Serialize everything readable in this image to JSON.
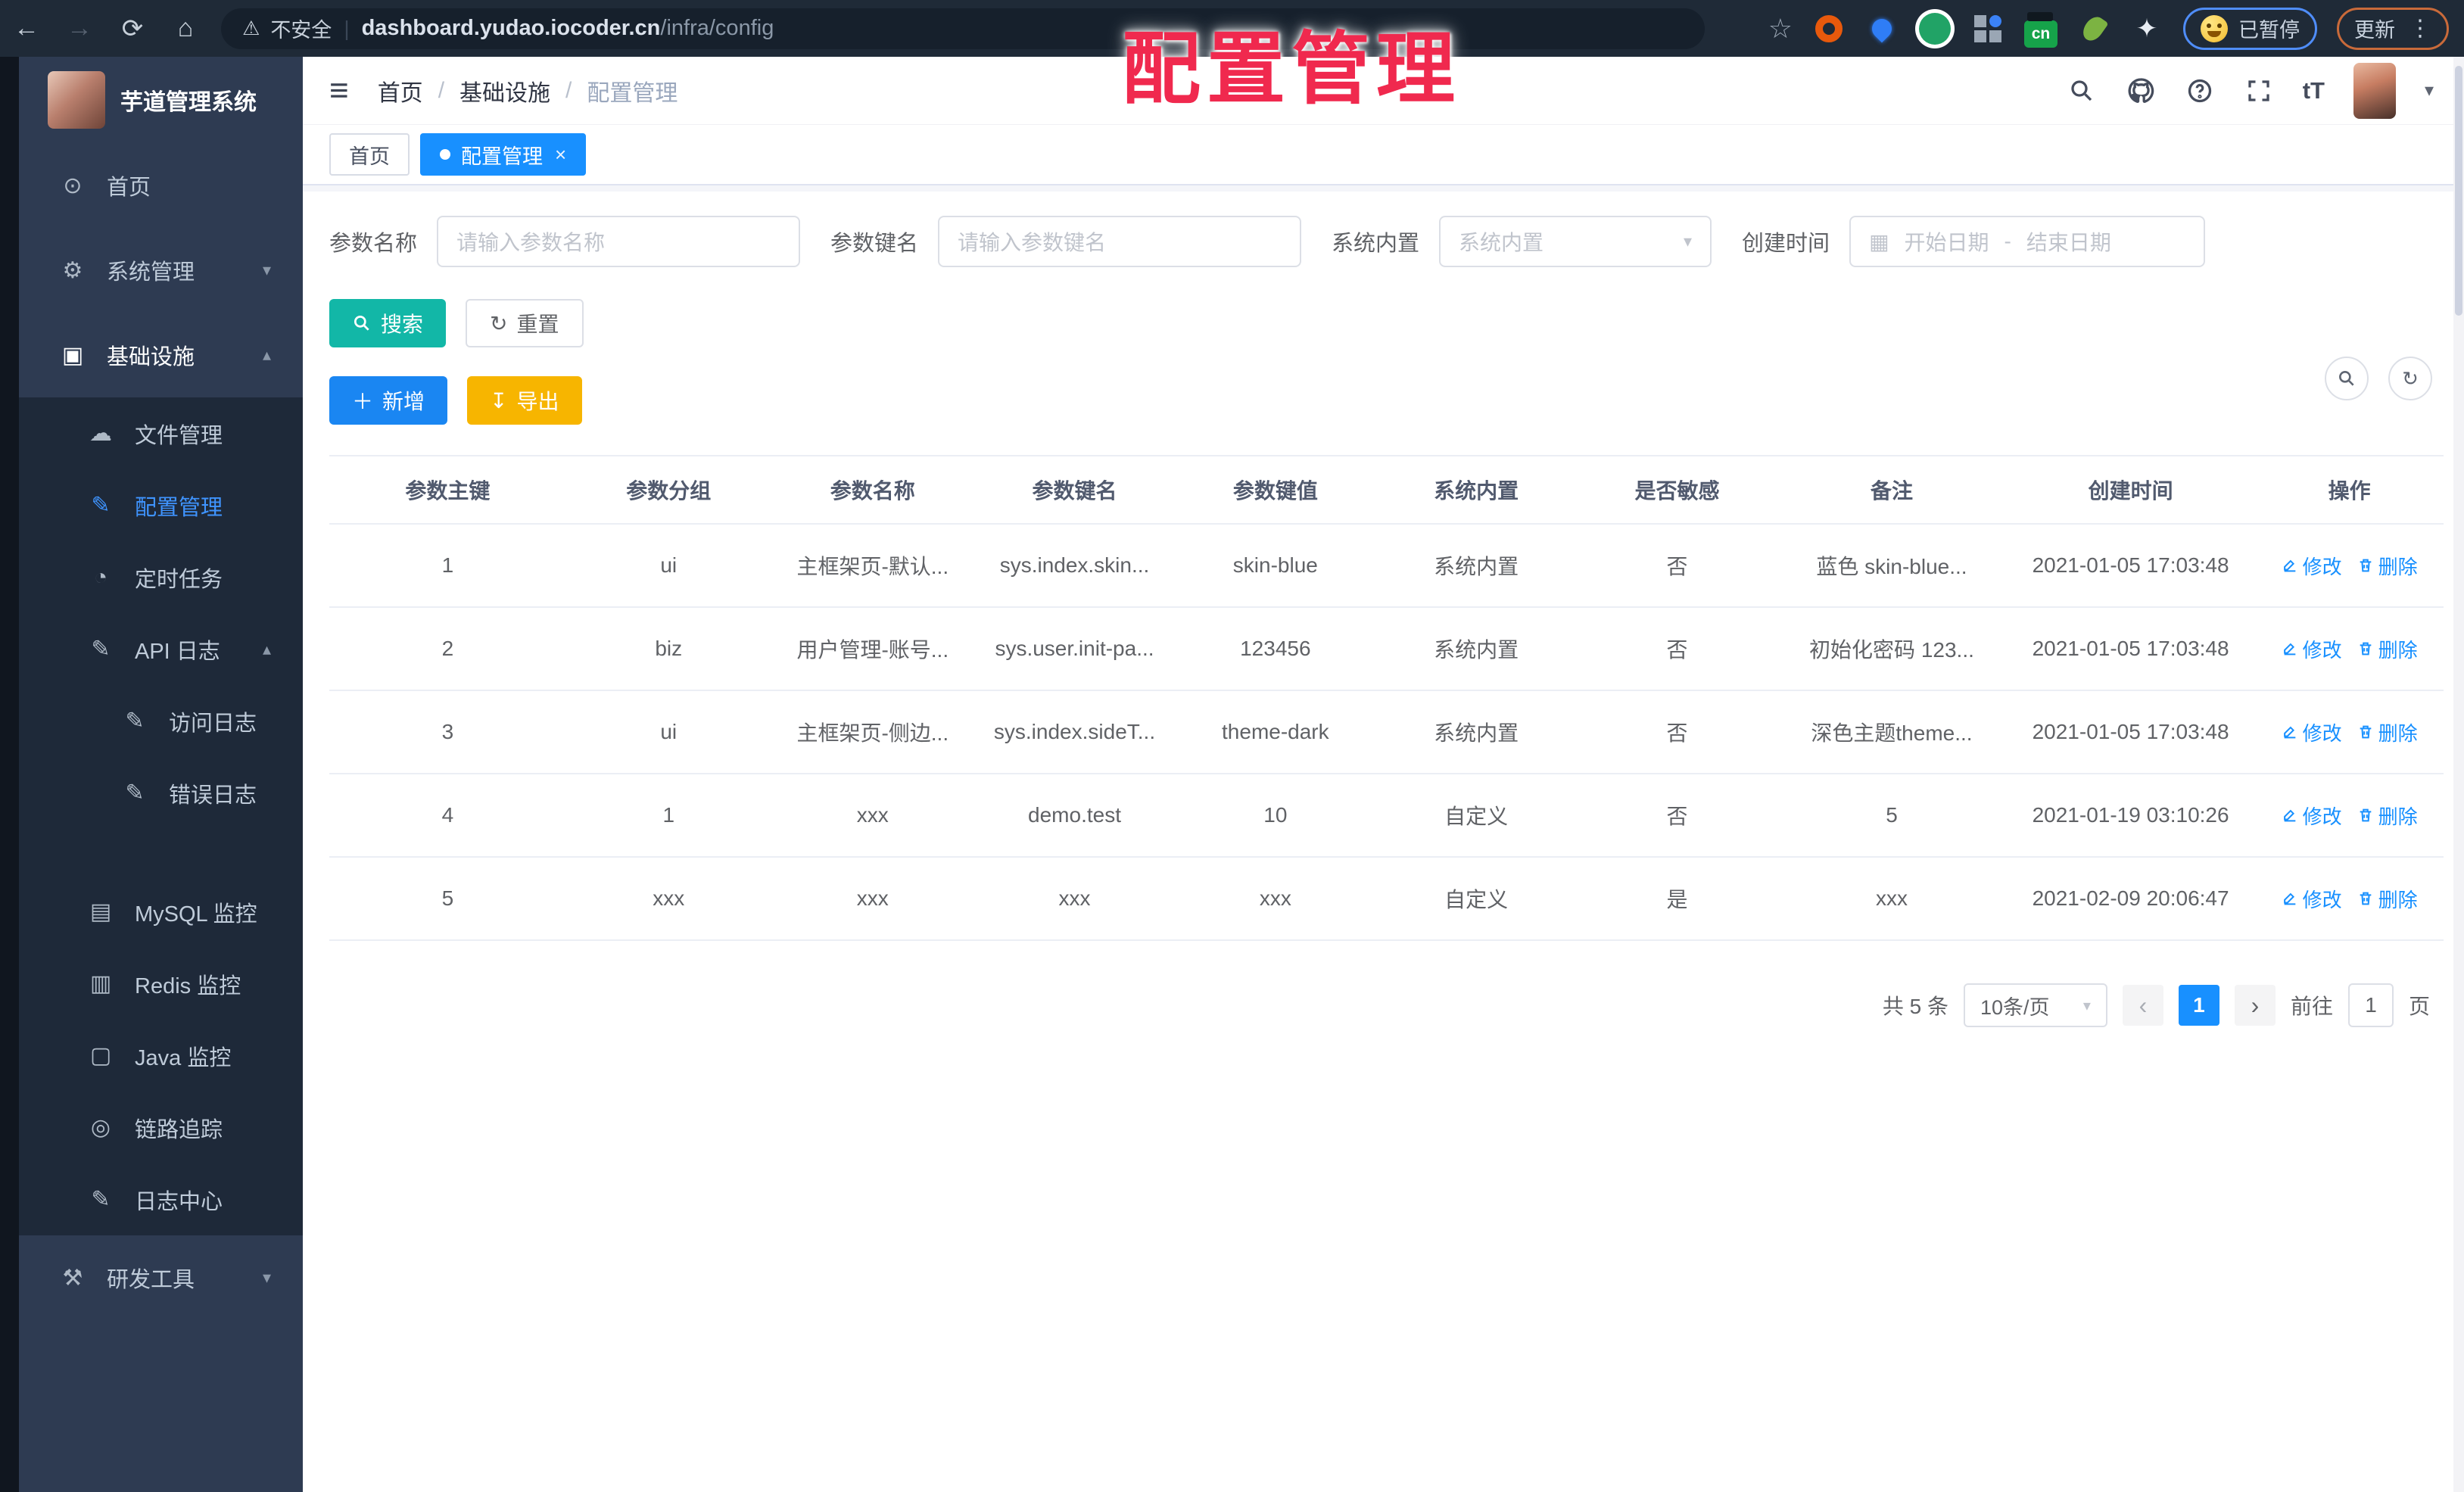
{
  "browser": {
    "security_label": "不安全",
    "url_domain": "dashboard.yudao.iocoder.cn",
    "url_path": "/infra/config",
    "cn_badge": "cn",
    "paused_badge": "已暂停",
    "update_button": "更新"
  },
  "overlay": {
    "title": "配置管理"
  },
  "sidebar": {
    "app_title": "芋道管理系统",
    "items": [
      {
        "label": "首页",
        "icon": "dashboard-icon",
        "level": "root",
        "chevron": "",
        "state": ""
      },
      {
        "label": "系统管理",
        "icon": "gear-icon",
        "level": "root",
        "chevron": "▾",
        "state": ""
      },
      {
        "label": "基础设施",
        "icon": "monitor-icon",
        "level": "root",
        "chevron": "▴",
        "state": "bright"
      },
      {
        "label": "文件管理",
        "icon": "cloud-icon",
        "level": "sub",
        "chevron": "",
        "state": ""
      },
      {
        "label": "配置管理",
        "icon": "edit-icon",
        "level": "sub",
        "chevron": "",
        "state": "active"
      },
      {
        "label": "定时任务",
        "icon": "timer-icon",
        "level": "sub",
        "chevron": "",
        "state": ""
      },
      {
        "label": "API 日志",
        "icon": "log-icon",
        "level": "sub",
        "chevron": "▴",
        "state": ""
      },
      {
        "label": "访问日志",
        "icon": "log-icon",
        "level": "child",
        "chevron": "",
        "state": ""
      },
      {
        "label": "错误日志",
        "icon": "log-icon",
        "level": "child",
        "chevron": "",
        "state": ""
      },
      {
        "label": "MySQL 监控",
        "icon": "mysql-icon",
        "level": "sub",
        "chevron": "",
        "state": "gap"
      },
      {
        "label": "Redis 监控",
        "icon": "redis-icon",
        "level": "sub",
        "chevron": "",
        "state": ""
      },
      {
        "label": "Java 监控",
        "icon": "java-icon",
        "level": "sub",
        "chevron": "",
        "state": ""
      },
      {
        "label": "链路追踪",
        "icon": "trace-icon",
        "level": "sub",
        "chevron": "",
        "state": ""
      },
      {
        "label": "日志中心",
        "icon": "log-icon",
        "level": "sub",
        "chevron": "",
        "state": ""
      },
      {
        "label": "研发工具",
        "icon": "tools-icon",
        "level": "root",
        "chevron": "▾",
        "state": ""
      }
    ]
  },
  "header": {
    "breadcrumb": {
      "items": [
        "首页",
        "基础设施",
        "配置管理"
      ],
      "separator": "/"
    },
    "tabs": [
      {
        "label": "首页",
        "active": false
      },
      {
        "label": "配置管理",
        "active": true
      }
    ]
  },
  "filters": {
    "name": {
      "label": "参数名称",
      "placeholder": "请输入参数名称"
    },
    "key": {
      "label": "参数键名",
      "placeholder": "请输入参数键名"
    },
    "type": {
      "label": "系统内置",
      "placeholder": "系统内置"
    },
    "date": {
      "label": "创建时间",
      "start_placeholder": "开始日期",
      "separator": "-",
      "end_placeholder": "结束日期"
    }
  },
  "actions": {
    "search": "搜索",
    "reset": "重置",
    "add": "新增",
    "export": "导出"
  },
  "table": {
    "columns": [
      "参数主键",
      "参数分组",
      "参数名称",
      "参数键名",
      "参数键值",
      "系统内置",
      "是否敏感",
      "备注",
      "创建时间",
      "操作"
    ],
    "rows": [
      [
        "1",
        "ui",
        "主框架页-默认...",
        "sys.index.skin...",
        "skin-blue",
        "系统内置",
        "否",
        "蓝色 skin-blue...",
        "2021-01-05 17:03:48"
      ],
      [
        "2",
        "biz",
        "用户管理-账号...",
        "sys.user.init-pa...",
        "123456",
        "系统内置",
        "否",
        "初始化密码 123...",
        "2021-01-05 17:03:48"
      ],
      [
        "3",
        "ui",
        "主框架页-侧边...",
        "sys.index.sideT...",
        "theme-dark",
        "系统内置",
        "否",
        "深色主题theme...",
        "2021-01-05 17:03:48"
      ],
      [
        "4",
        "1",
        "xxx",
        "demo.test",
        "10",
        "自定义",
        "否",
        "5",
        "2021-01-19 03:10:26"
      ],
      [
        "5",
        "xxx",
        "xxx",
        "xxx",
        "xxx",
        "自定义",
        "是",
        "xxx",
        "2021-02-09 20:06:47"
      ]
    ],
    "row_actions": {
      "edit": "修改",
      "delete": "删除"
    }
  },
  "pagination": {
    "total": "共 5 条",
    "page_size": "10条/页",
    "current_page": "1",
    "goto_label": "前往",
    "goto_value": "1",
    "page_unit": "页"
  }
}
